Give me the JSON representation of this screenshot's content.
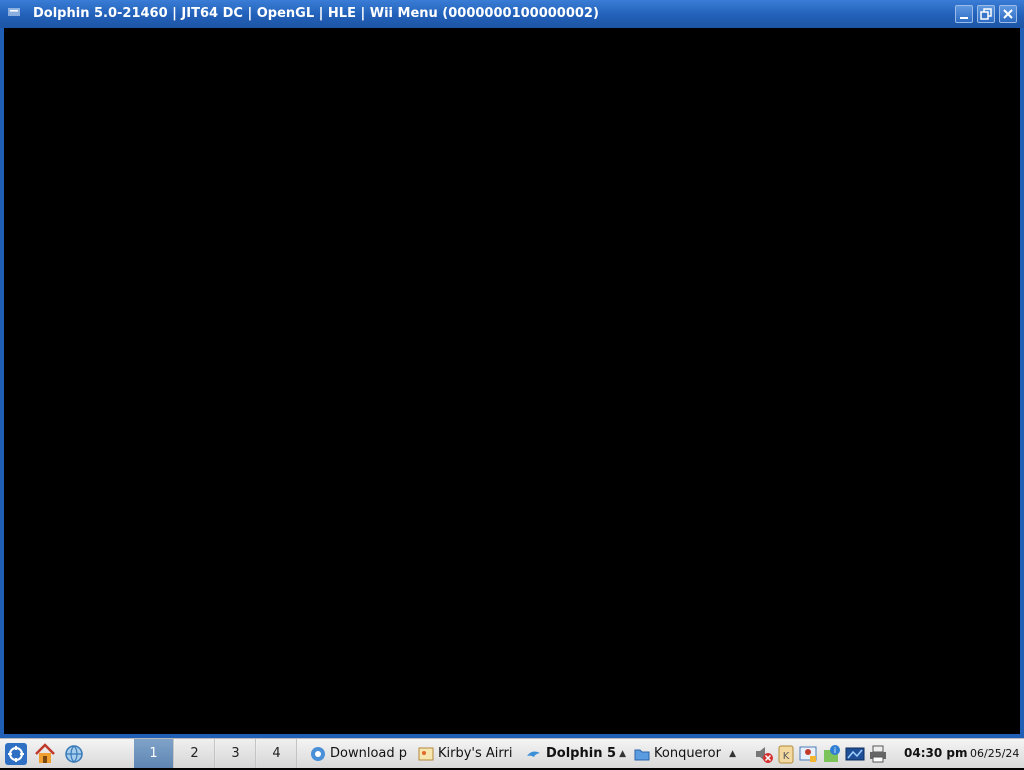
{
  "window": {
    "title": "Dolphin 5.0-21460 | JIT64 DC | OpenGL | HLE | Wii Menu (0000000100000002)",
    "icon": "dolphin-app-icon"
  },
  "taskbar": {
    "launchers": [
      {
        "name": "kde-menu-icon"
      },
      {
        "name": "home-icon"
      },
      {
        "name": "network-icon"
      }
    ],
    "pager": [
      "1",
      "2",
      "3",
      "4"
    ],
    "active_desktop": "1",
    "tasks": [
      {
        "label": "Download p",
        "icon": "browser-icon"
      },
      {
        "label": "Kirby's Airri",
        "icon": "image-icon"
      },
      {
        "label": "Dolphin 5",
        "icon": "dolphin-icon"
      },
      {
        "label": "Konqueror",
        "icon": "folder-icon"
      }
    ],
    "tray": [
      {
        "name": "volume-muted-icon"
      },
      {
        "name": "klipper-icon"
      },
      {
        "name": "user-lock-icon"
      },
      {
        "name": "update-icon"
      },
      {
        "name": "display-icon"
      },
      {
        "name": "printer-icon"
      }
    ],
    "clock": {
      "time": "04:30 pm",
      "date": "06/25/24"
    }
  }
}
